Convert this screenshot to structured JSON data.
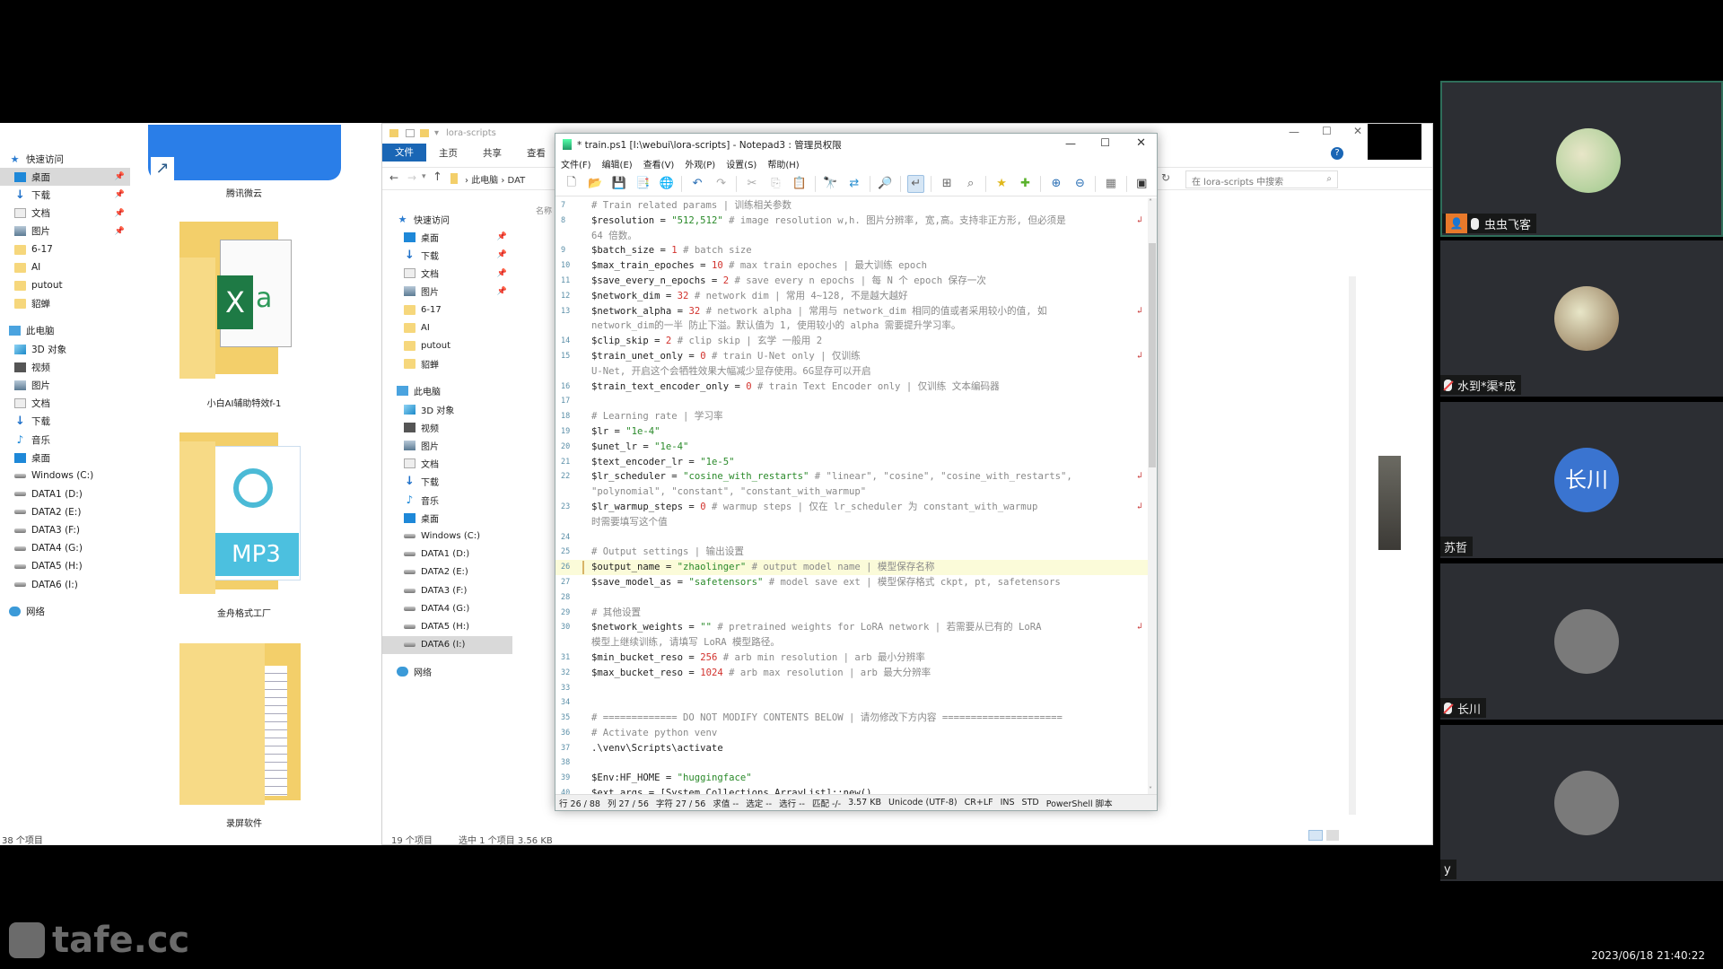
{
  "desktop_explorer": {
    "nav": [
      {
        "label": "快速访问",
        "icon": "star-icon",
        "pinned": false
      },
      {
        "label": "桌面",
        "icon": "desktop-icon",
        "pinned": true,
        "selected": true
      },
      {
        "label": "下载",
        "icon": "download-icon",
        "pinned": true
      },
      {
        "label": "文档",
        "icon": "document-icon",
        "pinned": true
      },
      {
        "label": "图片",
        "icon": "pictures-icon",
        "pinned": true
      },
      {
        "label": "6-17",
        "icon": "folder-icon"
      },
      {
        "label": "AI",
        "icon": "folder-icon"
      },
      {
        "label": "putout",
        "icon": "folder-icon"
      },
      {
        "label": "貂蝉",
        "icon": "folder-icon"
      },
      {
        "label": "此电脑",
        "icon": "pc-icon"
      },
      {
        "label": "3D 对象",
        "icon": "3d-objects-icon"
      },
      {
        "label": "视频",
        "icon": "video-icon"
      },
      {
        "label": "图片",
        "icon": "pictures-icon"
      },
      {
        "label": "文档",
        "icon": "document-icon"
      },
      {
        "label": "下载",
        "icon": "download-icon"
      },
      {
        "label": "音乐",
        "icon": "music-icon"
      },
      {
        "label": "桌面",
        "icon": "desktop-icon"
      },
      {
        "label": "Windows (C:)",
        "icon": "drive-icon"
      },
      {
        "label": "DATA1 (D:)",
        "icon": "drive-icon"
      },
      {
        "label": "DATA2 (E:)",
        "icon": "drive-icon"
      },
      {
        "label": "DATA3 (F:)",
        "icon": "drive-icon"
      },
      {
        "label": "DATA4 (G:)",
        "icon": "drive-icon"
      },
      {
        "label": "DATA5 (H:)",
        "icon": "drive-icon"
      },
      {
        "label": "DATA6 (I:)",
        "icon": "drive-icon"
      },
      {
        "label": "网络",
        "icon": "network-icon"
      }
    ],
    "items": [
      {
        "label": "腾讯微云"
      },
      {
        "label": "小白AI辅助特效f-1"
      },
      {
        "label": "金舟格式工厂"
      },
      {
        "label": "录屏软件"
      }
    ],
    "status": "38 个项目"
  },
  "explorer": {
    "title": "lora-scripts",
    "ribbon_tabs": [
      "文件",
      "主页",
      "共享",
      "查看"
    ],
    "breadcrumb": [
      "此电脑",
      "DAT"
    ],
    "column_header": "名称",
    "search_placeholder": "在 lora-scripts 中搜索",
    "nav": [
      {
        "label": "快速访问",
        "icon": "star-icon"
      },
      {
        "label": "桌面",
        "icon": "desktop-icon",
        "pinned": true
      },
      {
        "label": "下载",
        "icon": "download-icon",
        "pinned": true
      },
      {
        "label": "文档",
        "icon": "document-icon",
        "pinned": true
      },
      {
        "label": "图片",
        "icon": "pictures-icon",
        "pinned": true
      },
      {
        "label": "6-17",
        "icon": "folder-icon"
      },
      {
        "label": "AI",
        "icon": "folder-icon"
      },
      {
        "label": "putout",
        "icon": "folder-icon"
      },
      {
        "label": "貂蝉",
        "icon": "folder-icon"
      },
      {
        "label": "此电脑",
        "icon": "pc-icon"
      },
      {
        "label": "3D 对象",
        "icon": "3d-objects-icon"
      },
      {
        "label": "视频",
        "icon": "video-icon"
      },
      {
        "label": "图片",
        "icon": "pictures-icon"
      },
      {
        "label": "文档",
        "icon": "document-icon"
      },
      {
        "label": "下载",
        "icon": "download-icon"
      },
      {
        "label": "音乐",
        "icon": "music-icon"
      },
      {
        "label": "桌面",
        "icon": "desktop-icon"
      },
      {
        "label": "Windows (C:)",
        "icon": "drive-icon"
      },
      {
        "label": "DATA1 (D:)",
        "icon": "drive-icon"
      },
      {
        "label": "DATA2 (E:)",
        "icon": "drive-icon"
      },
      {
        "label": "DATA3 (F:)",
        "icon": "drive-icon"
      },
      {
        "label": "DATA4 (G:)",
        "icon": "drive-icon"
      },
      {
        "label": "DATA5 (H:)",
        "icon": "drive-icon"
      },
      {
        "label": "DATA6 (I:)",
        "icon": "drive-icon",
        "selected": true
      },
      {
        "label": "网络",
        "icon": "network-icon"
      }
    ],
    "status_items": "19 个项目",
    "status_selected": "选中 1 个项目  3.56 KB"
  },
  "notepad": {
    "title": "* train.ps1 [I:\\webui\\lora-scripts] - Notepad3 : 管理员权限",
    "menu": [
      "文件(F)",
      "编辑(E)",
      "查看(V)",
      "外观(P)",
      "设置(S)",
      "帮助(H)"
    ],
    "toolbar": [
      "new-icon",
      "open-icon",
      "save-icon",
      "save-as-icon",
      "browse-icon",
      "sep",
      "undo-icon",
      "redo-icon",
      "sep",
      "cut-icon",
      "copy-icon",
      "paste-icon",
      "sep",
      "find-icon",
      "replace-icon",
      "sep",
      "goto-icon",
      "sep",
      "word-wrap-icon",
      "sep",
      "view-icon",
      "zoom-fit-icon",
      "sep",
      "favorite-icon",
      "add-favorite-icon",
      "sep",
      "zoom-in-icon",
      "zoom-out-icon",
      "sep",
      "scheme-icon",
      "sep",
      "terminal-icon"
    ],
    "lines": [
      {
        "n": "7",
        "parts": [
          [
            "cmt",
            "# Train related params | 训练相关参数"
          ]
        ]
      },
      {
        "n": "8",
        "wrap": true,
        "parts": [
          [
            "",
            "$resolution = "
          ],
          [
            "str",
            "\"512,512\""
          ],
          [
            "cmt",
            " # image resolution w,h. 图片分辨率, 宽,高。支持非正方形, 但必须是"
          ]
        ]
      },
      {
        "n": "",
        "parts": [
          [
            "cmt",
            "64 倍数。"
          ]
        ]
      },
      {
        "n": "9",
        "parts": [
          [
            "",
            "$batch_size = "
          ],
          [
            "num",
            "1"
          ],
          [
            "cmt",
            " # batch size"
          ]
        ]
      },
      {
        "n": "10",
        "parts": [
          [
            "",
            "$max_train_epoches = "
          ],
          [
            "num",
            "10"
          ],
          [
            "cmt",
            " # max train epoches | 最大训练 epoch"
          ]
        ]
      },
      {
        "n": "11",
        "parts": [
          [
            "",
            "$save_every_n_epochs = "
          ],
          [
            "num",
            "2"
          ],
          [
            "cmt",
            " # save every n epochs | 每 N 个 epoch 保存一次"
          ]
        ]
      },
      {
        "n": "12",
        "parts": [
          [
            "",
            "$network_dim = "
          ],
          [
            "num",
            "32"
          ],
          [
            "cmt",
            " # network dim | 常用 4~128, 不是越大越好"
          ]
        ]
      },
      {
        "n": "13",
        "wrap": true,
        "parts": [
          [
            "",
            "$network_alpha = "
          ],
          [
            "num",
            "32"
          ],
          [
            "cmt",
            " # network alpha | 常用与 network_dim 相同的值或者采用较小的值, 如"
          ]
        ]
      },
      {
        "n": "",
        "parts": [
          [
            "cmt",
            "network_dim的一半 防止下溢。默认值为 1, 使用较小的 alpha 需要提升学习率。"
          ]
        ]
      },
      {
        "n": "14",
        "parts": [
          [
            "",
            "$clip_skip = "
          ],
          [
            "num",
            "2"
          ],
          [
            "cmt",
            " # clip skip | 玄学 一般用 2"
          ]
        ]
      },
      {
        "n": "15",
        "wrap": true,
        "parts": [
          [
            "",
            "$train_unet_only = "
          ],
          [
            "num",
            "0"
          ],
          [
            "cmt",
            " # train U-Net only | 仅训练"
          ]
        ]
      },
      {
        "n": "",
        "parts": [
          [
            "cmt",
            "U-Net, 开启这个会牺牲效果大幅减少显存使用。6G显存可以开启"
          ]
        ]
      },
      {
        "n": "16",
        "parts": [
          [
            "",
            "$train_text_encoder_only = "
          ],
          [
            "num",
            "0"
          ],
          [
            "cmt",
            " # train Text Encoder only | 仅训练 文本编码器"
          ]
        ]
      },
      {
        "n": "17",
        "parts": []
      },
      {
        "n": "18",
        "parts": [
          [
            "cmt",
            "# Learning rate | 学习率"
          ]
        ]
      },
      {
        "n": "19",
        "parts": [
          [
            "",
            "$lr = "
          ],
          [
            "str",
            "\"1e-4\""
          ]
        ]
      },
      {
        "n": "20",
        "parts": [
          [
            "",
            "$unet_lr = "
          ],
          [
            "str",
            "\"1e-4\""
          ]
        ]
      },
      {
        "n": "21",
        "parts": [
          [
            "",
            "$text_encoder_lr = "
          ],
          [
            "str",
            "\"1e-5\""
          ]
        ]
      },
      {
        "n": "22",
        "wrap": true,
        "parts": [
          [
            "",
            "$lr_scheduler = "
          ],
          [
            "str",
            "\"cosine_with_restarts\""
          ],
          [
            "cmt",
            " # \"linear\", \"cosine\", \"cosine_with_restarts\","
          ]
        ]
      },
      {
        "n": "",
        "parts": [
          [
            "cmt",
            "\"polynomial\", \"constant\", \"constant_with_warmup\""
          ]
        ]
      },
      {
        "n": "23",
        "wrap": true,
        "parts": [
          [
            "",
            "$lr_warmup_steps = "
          ],
          [
            "num",
            "0"
          ],
          [
            "cmt",
            " # warmup steps | 仅在 lr_scheduler 为 constant_with_warmup"
          ]
        ]
      },
      {
        "n": "",
        "parts": [
          [
            "cmt",
            "时需要填写这个值"
          ]
        ]
      },
      {
        "n": "24",
        "parts": []
      },
      {
        "n": "25",
        "parts": [
          [
            "cmt",
            "# Output settings | 输出设置"
          ]
        ]
      },
      {
        "n": "26",
        "current": true,
        "parts": [
          [
            "",
            "$output_name = "
          ],
          [
            "str",
            "\"zhaolinger\""
          ],
          [
            "cmt",
            " # output model name | 模型保存名称"
          ]
        ]
      },
      {
        "n": "27",
        "parts": [
          [
            "",
            "$save_model_as = "
          ],
          [
            "str",
            "\"safetensors\""
          ],
          [
            "cmt",
            " # model save ext | 模型保存格式 ckpt, pt, safetensors"
          ]
        ]
      },
      {
        "n": "28",
        "parts": []
      },
      {
        "n": "29",
        "parts": [
          [
            "cmt",
            "# 其他设置"
          ]
        ]
      },
      {
        "n": "30",
        "wrap": true,
        "parts": [
          [
            "",
            "$network_weights = "
          ],
          [
            "str",
            "\"\""
          ],
          [
            "cmt",
            " # pretrained weights for LoRA network | 若需要从已有的 LoRA"
          ]
        ]
      },
      {
        "n": "",
        "parts": [
          [
            "cmt",
            "模型上继续训练, 请填写 LoRA 模型路径。"
          ]
        ]
      },
      {
        "n": "31",
        "parts": [
          [
            "",
            "$min_bucket_reso = "
          ],
          [
            "num",
            "256"
          ],
          [
            "cmt",
            " # arb min resolution | arb 最小分辨率"
          ]
        ]
      },
      {
        "n": "32",
        "parts": [
          [
            "",
            "$max_bucket_reso = "
          ],
          [
            "num",
            "1024"
          ],
          [
            "cmt",
            " # arb max resolution | arb 最大分辨率"
          ]
        ]
      },
      {
        "n": "33",
        "parts": []
      },
      {
        "n": "34",
        "parts": []
      },
      {
        "n": "35",
        "parts": [
          [
            "cmt",
            "# ============= DO NOT MODIFY CONTENTS BELOW | 请勿修改下方内容 ====================="
          ]
        ]
      },
      {
        "n": "36",
        "parts": [
          [
            "cmt",
            "# Activate python venv"
          ]
        ]
      },
      {
        "n": "37",
        "parts": [
          [
            "",
            ".\\venv\\Scripts\\activate"
          ]
        ]
      },
      {
        "n": "38",
        "parts": []
      },
      {
        "n": "39",
        "parts": [
          [
            "",
            "$Env:HF_HOME = "
          ],
          [
            "str",
            "\"huggingface\""
          ]
        ]
      },
      {
        "n": "40",
        "parts": [
          [
            "",
            "$ext_args = [System.Collections.ArrayList]::new()"
          ]
        ]
      }
    ],
    "status": [
      "行 26 / 88",
      "列 27 / 56",
      "字符 27 / 56",
      "求值 --",
      "选定 --",
      "选行 --",
      "匹配 -/-",
      "3.57 KB",
      "Unicode (UTF-8)",
      "CR+LF",
      "INS",
      "STD",
      "PowerShell 脚本"
    ]
  },
  "meeting": {
    "participants": [
      {
        "name": "虫虫飞客",
        "host": true,
        "mic": "on",
        "avatar_type": "photo",
        "avatar_color": "#9cc88a"
      },
      {
        "name": "水到*渠*成",
        "mic": "muted",
        "avatar_type": "photo",
        "avatar_color": "#8a6f4e"
      },
      {
        "name": "苏哲",
        "avatar_type": "initials",
        "initials": "长川",
        "avatar_color": "#3a74d0"
      },
      {
        "name": "长川",
        "mic": "muted",
        "avatar_type": "blank",
        "avatar_color": "#7a7a7a"
      },
      {
        "name": "y",
        "avatar_type": "blank",
        "avatar_color": "#7a7a7a"
      }
    ]
  },
  "watermark": "tafe.cc",
  "timestamp": "2023/06/18 21:40:22"
}
